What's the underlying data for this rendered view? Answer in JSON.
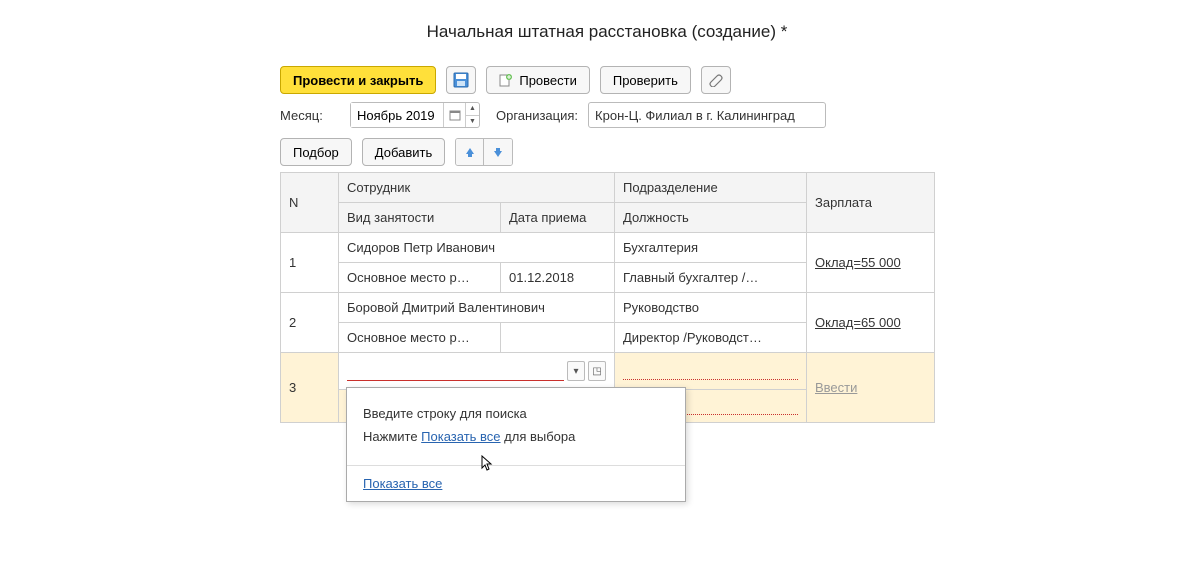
{
  "title": "Начальная штатная расстановка (создание) *",
  "toolbar": {
    "submit_close": "Провести и закрыть",
    "submit": "Провести",
    "check": "Проверить"
  },
  "form": {
    "month_label": "Месяц:",
    "month_value": "Ноябрь 2019",
    "org_label": "Организация:",
    "org_value": "Крон-Ц. Филиал в г. Калининград"
  },
  "toolbar2": {
    "pick": "Подбор",
    "add": "Добавить"
  },
  "columns": {
    "n": "N",
    "employee": "Сотрудник",
    "emp_type": "Вид занятости",
    "hire_date": "Дата приема",
    "department": "Подразделение",
    "position": "Должность",
    "salary": "Зарплата"
  },
  "rows": [
    {
      "n": "1",
      "employee": "Сидоров Петр Иванович",
      "emp_type": "Основное место р…",
      "hire_date": "01.12.2018",
      "department": "Бухгалтерия",
      "position": "Главный бухгалтер /…",
      "salary": "Оклад=55 000"
    },
    {
      "n": "2",
      "employee": "Боровой Дмитрий Валентинович",
      "emp_type": "Основное место р…",
      "hire_date": "",
      "department": "Руководство",
      "position": "Директор /Руководст…",
      "salary": "Оклад=65 000"
    }
  ],
  "newrow": {
    "n": "3",
    "salary_action": "Ввести"
  },
  "popup": {
    "line1": "Введите строку для поиска",
    "line2a": "Нажмите ",
    "line2_link": "Показать все",
    "line2b": " для выбора",
    "footer_link": "Показать все"
  }
}
